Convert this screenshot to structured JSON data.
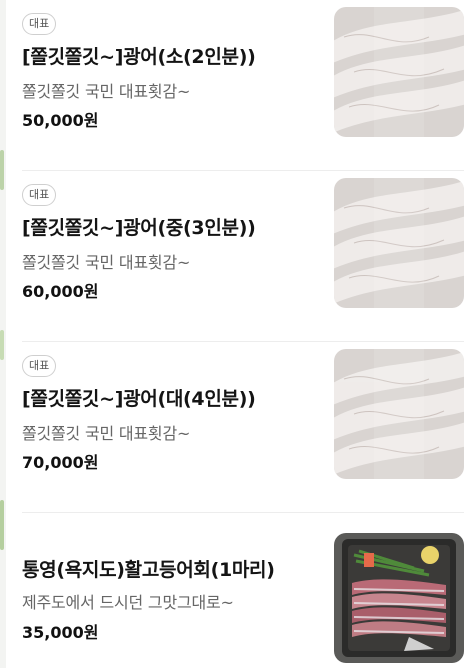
{
  "menu": {
    "items": [
      {
        "badge": "대표",
        "name": "[쫄깃쫄깃~]광어(소(2인분))",
        "description": "쫄깃쫄깃 국민 대표횟감~",
        "price": "50,000원",
        "image_icon": "sliced-flounder-sashimi-photo"
      },
      {
        "badge": "대표",
        "name": "[쫄깃쫄깃~]광어(중(3인분))",
        "description": "쫄깃쫄깃 국민 대표횟감~",
        "price": "60,000원",
        "image_icon": "sliced-flounder-sashimi-photo"
      },
      {
        "badge": "대표",
        "name": "[쫄깃쫄깃~]광어(대(4인분))",
        "description": "쫄깃쫄깃 국민 대표횟감~",
        "price": "70,000원",
        "image_icon": "sliced-flounder-sashimi-photo"
      },
      {
        "name": "통영(욕지도)활고등어회(1마리)",
        "description": "제주도에서 드시던 그맛그대로~",
        "price": "35,000원",
        "image_icon": "mackerel-sashimi-tray-photo"
      }
    ]
  },
  "colors": {
    "badge_border": "#cfcfcf",
    "price_text": "#111111",
    "description_text": "#666666",
    "divider": "#ededed"
  }
}
